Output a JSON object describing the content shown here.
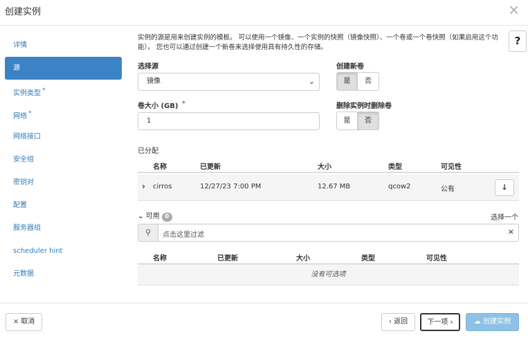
{
  "modal": {
    "title": "创建实例",
    "close_glyph": "×"
  },
  "sidebar": {
    "items": [
      {
        "label": "详情",
        "required": false,
        "active": false
      },
      {
        "label": "源",
        "required": false,
        "active": true
      },
      {
        "label": "实例类型",
        "required": true,
        "active": false
      },
      {
        "label": "网络",
        "required": true,
        "active": false
      },
      {
        "label": "网络接口",
        "required": false,
        "active": false
      },
      {
        "label": "安全组",
        "required": false,
        "active": false
      },
      {
        "label": "密钥对",
        "required": false,
        "active": false
      },
      {
        "label": "配置",
        "required": false,
        "active": false
      },
      {
        "label": "服务器组",
        "required": false,
        "active": false
      },
      {
        "label": "scheduler hint",
        "required": false,
        "active": false
      },
      {
        "label": "元数据",
        "required": false,
        "active": false
      }
    ],
    "required_mark": "*"
  },
  "source": {
    "description": "实例的源是用来创建实例的模板。 可以使用一个镜像、一个实例的快照（镜像快照）、一个卷或一个卷快照（如果启用这个功能）。 您也可以通过创建一个新卷来选择使用具有持久性的存储。",
    "help_glyph": "?",
    "select_source_label": "选择源",
    "select_source_value": "镜像",
    "create_volume_label": "创建新卷",
    "create_volume_yes": "是",
    "create_volume_no": "否",
    "volume_size_label": "卷大小 (GB)",
    "volume_size_value": "1",
    "delete_volume_label": "删除实例时删除卷",
    "delete_volume_yes": "是",
    "delete_volume_no": "否"
  },
  "allocated": {
    "label": "已分配",
    "columns": [
      "名称",
      "已更新",
      "大小",
      "类型",
      "可见性"
    ],
    "rows": [
      {
        "name": "cirros",
        "updated": "12/27/23 7:00 PM",
        "size": "12.67 MB",
        "type": "qcow2",
        "visibility": "公有"
      }
    ]
  },
  "available": {
    "label": "可用",
    "count": "0",
    "select_one": "选择一个",
    "filter_placeholder": "点击这里过滤",
    "columns": [
      "名称",
      "已更新",
      "大小",
      "类型",
      "可见性"
    ],
    "empty_text": "没有可选项"
  },
  "footer": {
    "cancel_label": "取消",
    "back_label": "‹ 返回",
    "next_label": "下一项 ›",
    "create_label": "创建实例"
  },
  "colors": {
    "active_nav": "#3b83c5",
    "link": "#337ab7",
    "primary_disabled": "#8fc1e6"
  }
}
